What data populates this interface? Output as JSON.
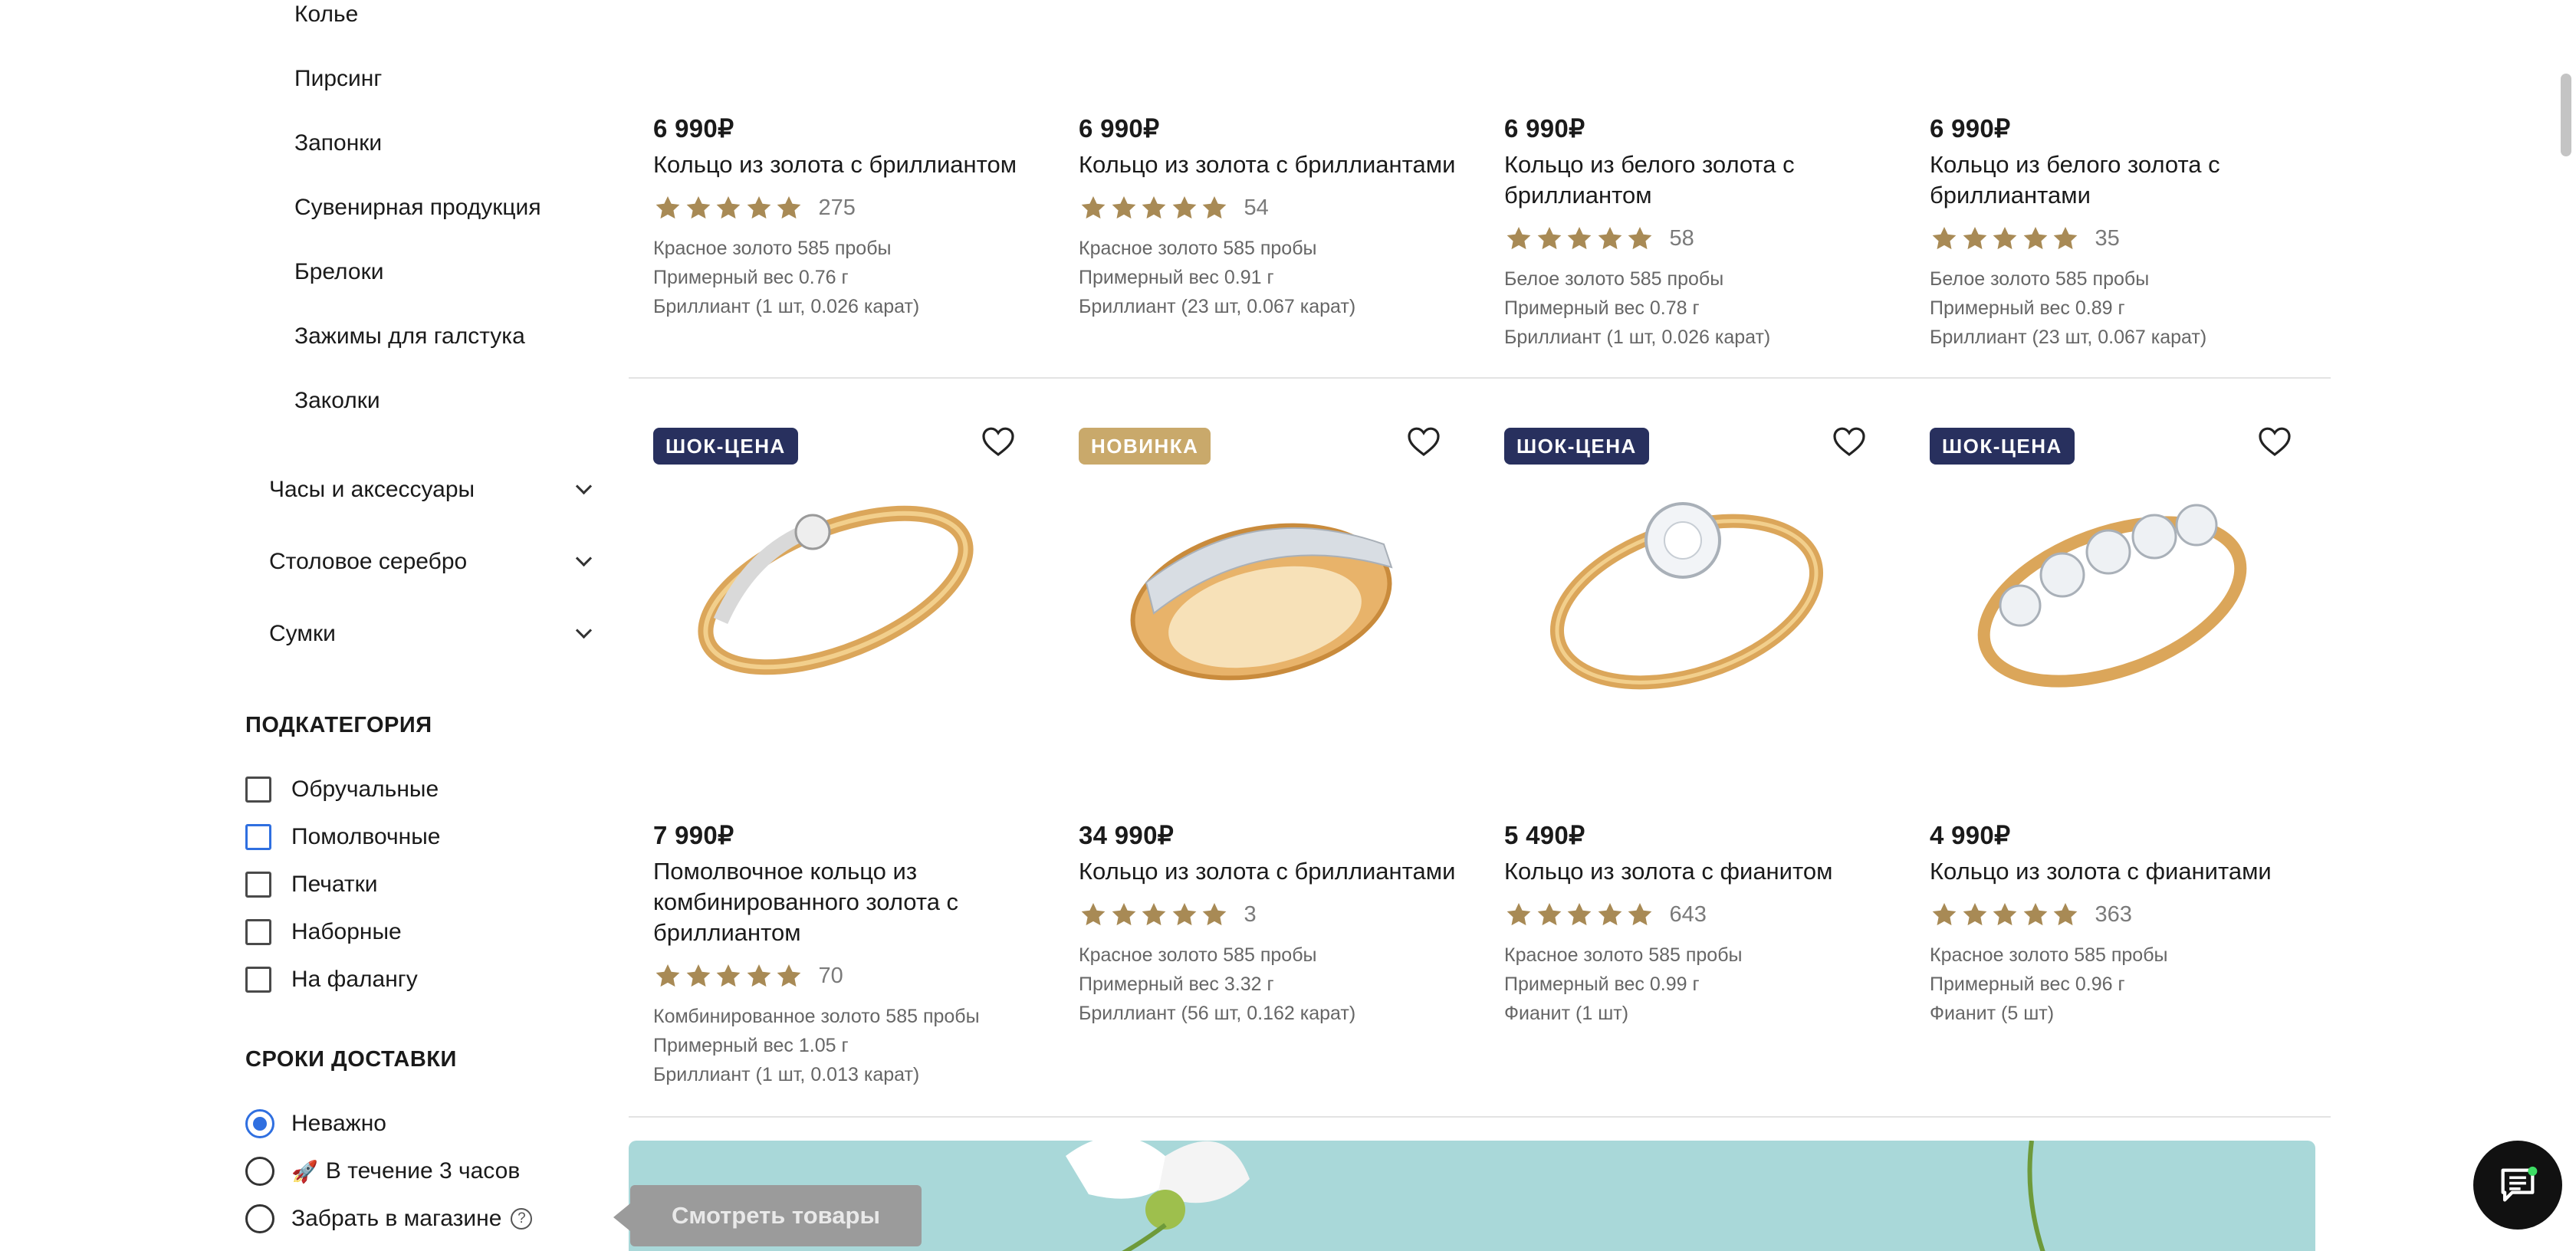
{
  "sidebar": {
    "items": [
      "Колье",
      "Пирсинг",
      "Запонки",
      "Сувенирная продукция",
      "Брелоки",
      "Зажимы для галстука",
      "Заколки"
    ],
    "groups": [
      "Часы и аксессуары",
      "Столовое серебро",
      "Сумки"
    ],
    "subcategory": {
      "title": "ПОДКАТЕГОРИЯ",
      "options": [
        "Обручальные",
        "Помолвочные",
        "Печатки",
        "Наборные",
        "На фалангу"
      ]
    },
    "delivery": {
      "title": "СРОКИ ДОСТАВКИ",
      "options": [
        "Неважно",
        "В течение 3 часов",
        "Забрать в магазине"
      ],
      "selected": "Неважно",
      "help": "?"
    }
  },
  "products_top": [
    {
      "price": "6 990₽",
      "title": "Кольцо из золота с бриллиантом",
      "rating": 5,
      "reviews": "275",
      "specs": [
        "Красное золото 585 пробы",
        "Примерный вес 0.76 г",
        "Бриллиант (1 шт, 0.026 карат)"
      ]
    },
    {
      "price": "6 990₽",
      "title": "Кольцо из золота с бриллиантами",
      "rating": 5,
      "reviews": "54",
      "specs": [
        "Красное золото 585 пробы",
        "Примерный вес 0.91 г",
        "Бриллиант (23 шт, 0.067 карат)"
      ]
    },
    {
      "price": "6 990₽",
      "title": "Кольцо из белого золота с бриллиантом",
      "rating": 5,
      "reviews": "58",
      "specs": [
        "Белое золото 585 пробы",
        "Примерный вес 0.78 г",
        "Бриллиант (1 шт, 0.026 карат)"
      ]
    },
    {
      "price": "6 990₽",
      "title": "Кольцо из белого золота с бриллиантами",
      "rating": 5,
      "reviews": "35",
      "specs": [
        "Белое золото 585 пробы",
        "Примерный вес 0.89 г",
        "Бриллиант (23 шт, 0.067 карат)"
      ]
    }
  ],
  "products_bottom": [
    {
      "badge": "ШОК-ЦЕНА",
      "badge_style": "dark",
      "price": "7 990₽",
      "title": "Помолвочное кольцо из комбинированного золота с бриллиантом",
      "rating": 5,
      "reviews": "70",
      "specs": [
        "Комбинированное золото 585 пробы",
        "Примерный вес 1.05 г",
        "Бриллиант (1 шт, 0.013 карат)"
      ]
    },
    {
      "badge": "НОВИНКА",
      "badge_style": "gold",
      "price": "34 990₽",
      "title": "Кольцо из золота с бриллиантами",
      "rating": 5,
      "reviews": "3",
      "specs": [
        "Красное золото 585 пробы",
        "Примерный вес 3.32 г",
        "Бриллиант (56 шт, 0.162 карат)"
      ]
    },
    {
      "badge": "ШОК-ЦЕНА",
      "badge_style": "dark",
      "price": "5 490₽",
      "title": "Кольцо из золота с фианитом",
      "rating": 5,
      "reviews": "643",
      "specs": [
        "Красное золото 585 пробы",
        "Примерный вес 0.99 г",
        "Фианит (1 шт)"
      ]
    },
    {
      "badge": "ШОК-ЦЕНА",
      "badge_style": "dark",
      "price": "4 990₽",
      "title": "Кольцо из золота с фианитами",
      "rating": 5,
      "reviews": "363",
      "specs": [
        "Красное золото 585 пробы",
        "Примерный вес 0.96 г",
        "Фианит (5 шт)"
      ]
    }
  ],
  "banner": {
    "button_label": "Смотреть товары"
  },
  "icons": {
    "star": "star-icon",
    "heart": "heart-icon",
    "chat": "chat-icon",
    "rocket": "rocket-icon",
    "chevron": "chevron-down-icon"
  },
  "colors": {
    "star": "#a88a55",
    "badge_dark": "#28305e",
    "badge_gold": "#c9a96b",
    "accent_blue": "#2f6fe0",
    "banner": "#a9d8d9"
  }
}
